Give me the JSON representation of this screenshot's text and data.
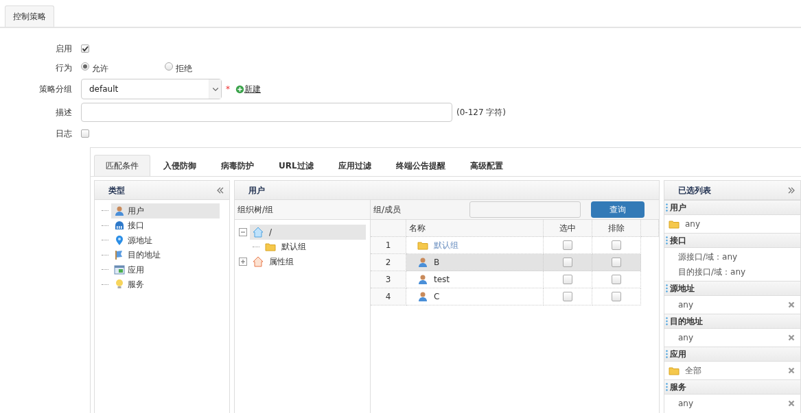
{
  "page_tabs": [
    {
      "label": "控制策略",
      "selected": true
    }
  ],
  "form": {
    "enable": {
      "label": "启用",
      "checked": true
    },
    "action": {
      "label": "行为",
      "options": [
        {
          "label": "允许",
          "selected": true
        },
        {
          "label": "拒绝",
          "selected": false
        }
      ]
    },
    "group": {
      "label": "策略分组",
      "value": "default",
      "required_mark": "*",
      "new_link": "新建"
    },
    "description": {
      "label": "描述",
      "hint": "(0-127 字符)"
    },
    "log": {
      "label": "日志",
      "checked": false
    }
  },
  "tabs": [
    {
      "label": "匹配条件",
      "selected": true
    },
    {
      "label": "入侵防御",
      "selected": false
    },
    {
      "label": "病毒防护",
      "selected": false
    },
    {
      "label": "URL过滤",
      "selected": false
    },
    {
      "label": "应用过滤",
      "selected": false
    },
    {
      "label": "终端公告提醒",
      "selected": false
    },
    {
      "label": "高级配置",
      "selected": false
    }
  ],
  "type_panel": {
    "title": "类型",
    "items": [
      {
        "label": "用户",
        "kind": "user",
        "selected": true
      },
      {
        "label": "接口",
        "kind": "interface",
        "selected": false
      },
      {
        "label": "源地址",
        "kind": "pin",
        "selected": false
      },
      {
        "label": "目的地址",
        "kind": "flag",
        "selected": false
      },
      {
        "label": "应用",
        "kind": "app",
        "selected": false
      },
      {
        "label": "服务",
        "kind": "bulb",
        "selected": false
      }
    ]
  },
  "user_panel": {
    "title": "用户",
    "tree_header": "组织树/组",
    "tree": [
      {
        "label": "/",
        "kind": "home",
        "expanded": true,
        "selected": true,
        "children": [
          {
            "label": "默认组",
            "kind": "folder",
            "selected": false
          }
        ]
      },
      {
        "label": "属性组",
        "kind": "home_orange",
        "expanded": false,
        "selected": false
      }
    ],
    "members_header": "组/成员",
    "search_button": "查询",
    "columns": [
      "名称",
      "选中",
      "排除"
    ],
    "rows": [
      {
        "index": "1",
        "name": "默认组",
        "kind": "folder",
        "selected": false,
        "include": false,
        "exclude": false
      },
      {
        "index": "2",
        "name": "B",
        "kind": "user",
        "selected": true,
        "include": false,
        "exclude": false
      },
      {
        "index": "3",
        "name": "test",
        "kind": "user",
        "selected": false,
        "include": false,
        "exclude": false
      },
      {
        "index": "4",
        "name": "C",
        "kind": "user",
        "selected": false,
        "include": false,
        "exclude": false
      }
    ]
  },
  "selected_panel": {
    "title": "已选列表",
    "sections": [
      {
        "title": "用户",
        "items": [
          {
            "text": "any",
            "kind": "folder",
            "removable": false
          }
        ]
      },
      {
        "title": "接口",
        "items": [
          {
            "text": "源接口/域：any",
            "kind": "plain",
            "removable": false
          },
          {
            "text": "目的接口/域：any",
            "kind": "plain",
            "removable": false
          }
        ]
      },
      {
        "title": "源地址",
        "items": [
          {
            "text": "any",
            "kind": "plain",
            "removable": true
          }
        ]
      },
      {
        "title": "目的地址",
        "items": [
          {
            "text": "any",
            "kind": "plain",
            "removable": true
          }
        ]
      },
      {
        "title": "应用",
        "items": [
          {
            "text": "全部",
            "kind": "folder",
            "removable": true
          }
        ]
      },
      {
        "title": "服务",
        "items": [
          {
            "text": "any",
            "kind": "plain",
            "removable": true
          }
        ]
      }
    ]
  }
}
